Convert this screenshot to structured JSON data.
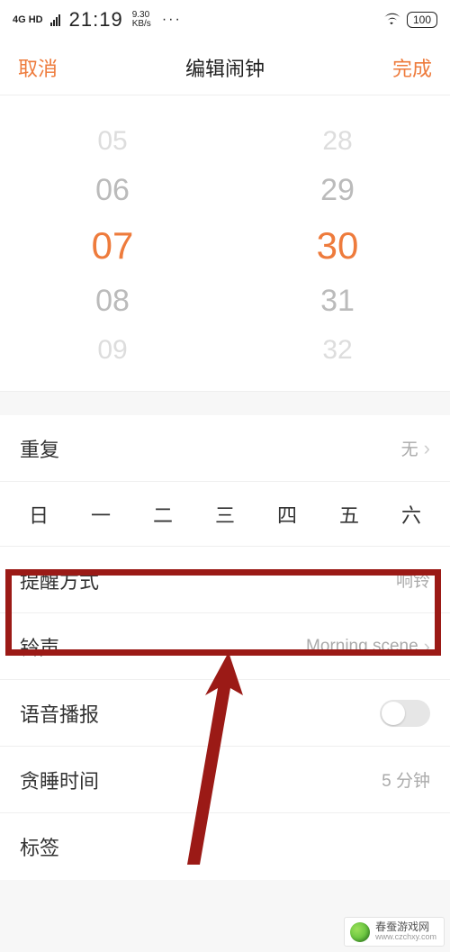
{
  "colors": {
    "accent": "#ee7b3c",
    "annot": "#9b1a16"
  },
  "statusbar": {
    "network": "4G HD",
    "clock": "21:19",
    "speed_top": "9.30",
    "speed_bottom": "KB/s",
    "dots": "···",
    "battery": "100"
  },
  "navbar": {
    "cancel": "取消",
    "title": "编辑闹钟",
    "done": "完成"
  },
  "picker": {
    "hours": [
      "05",
      "06",
      "07",
      "08",
      "09"
    ],
    "minutes": [
      "28",
      "29",
      "30",
      "31",
      "32"
    ]
  },
  "settings": {
    "repeat": {
      "label": "重复",
      "value": "无"
    },
    "weekdays": [
      "日",
      "一",
      "二",
      "三",
      "四",
      "五",
      "六"
    ],
    "remind_mode": {
      "label": "提醒方式",
      "value": "响铃"
    },
    "ringtone": {
      "label": "铃声",
      "value": "Morning scene"
    },
    "voice": {
      "label": "语音播报",
      "on": false
    },
    "snooze": {
      "label": "贪睡时间",
      "value": "5 分钟"
    },
    "tag": {
      "label": "标签",
      "value": ""
    }
  },
  "watermark": {
    "title": "春蚕游戏网",
    "sub": "www.czchxy.com"
  }
}
